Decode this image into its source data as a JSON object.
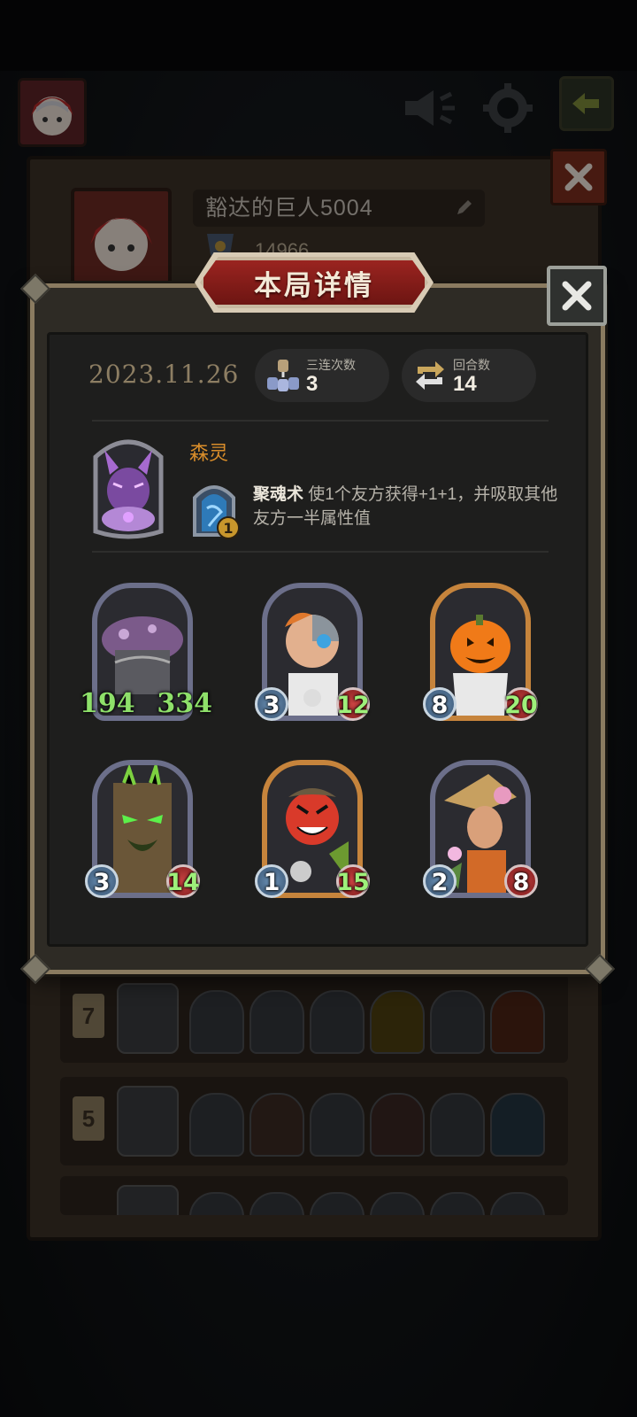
{
  "background": {
    "player_name": "豁达的巨人5004",
    "player_score": "14966",
    "list_rows": [
      {
        "rank": "7"
      },
      {
        "rank": "5"
      },
      {
        "rank": ""
      }
    ]
  },
  "modal": {
    "title": "本局详情",
    "date": "2023.11.26",
    "stats": [
      {
        "label": "三连次数",
        "value": "3",
        "icon": "triple-merge-icon"
      },
      {
        "label": "回合数",
        "value": "14",
        "icon": "turn-cycle-icon"
      }
    ],
    "leader": {
      "name": "森灵",
      "skill_name": "聚魂术",
      "skill_text": "使1个友方获得+1+1，并吸取其他友方一半属性值",
      "skill_level": "1"
    },
    "units": [
      {
        "name": "mushroom-unit",
        "atk": "194",
        "hp": "334",
        "buffed_atk": true,
        "buffed_hp": true,
        "orbs": false,
        "rarity": "silver"
      },
      {
        "name": "cyborg-doctor-unit",
        "atk": "3",
        "hp": "12",
        "buffed_atk": false,
        "buffed_hp": true,
        "orbs": true,
        "rarity": "silver"
      },
      {
        "name": "pumpkin-ghost-unit",
        "atk": "8",
        "hp": "20",
        "buffed_atk": false,
        "buffed_hp": true,
        "orbs": true,
        "rarity": "gold"
      },
      {
        "name": "treant-unit",
        "atk": "3",
        "hp": "14",
        "buffed_atk": false,
        "buffed_hp": true,
        "orbs": true,
        "rarity": "silver"
      },
      {
        "name": "tomato-imp-unit",
        "atk": "1",
        "hp": "15",
        "buffed_atk": false,
        "buffed_hp": true,
        "orbs": true,
        "rarity": "gold"
      },
      {
        "name": "flower-dryad-unit",
        "atk": "2",
        "hp": "8",
        "buffed_atk": false,
        "buffed_hp": false,
        "orbs": true,
        "rarity": "silver"
      }
    ]
  },
  "colors": {
    "accent_red": "#9a2420",
    "leader_name": "#d98d2a",
    "buff_green": "#8ee06a"
  }
}
